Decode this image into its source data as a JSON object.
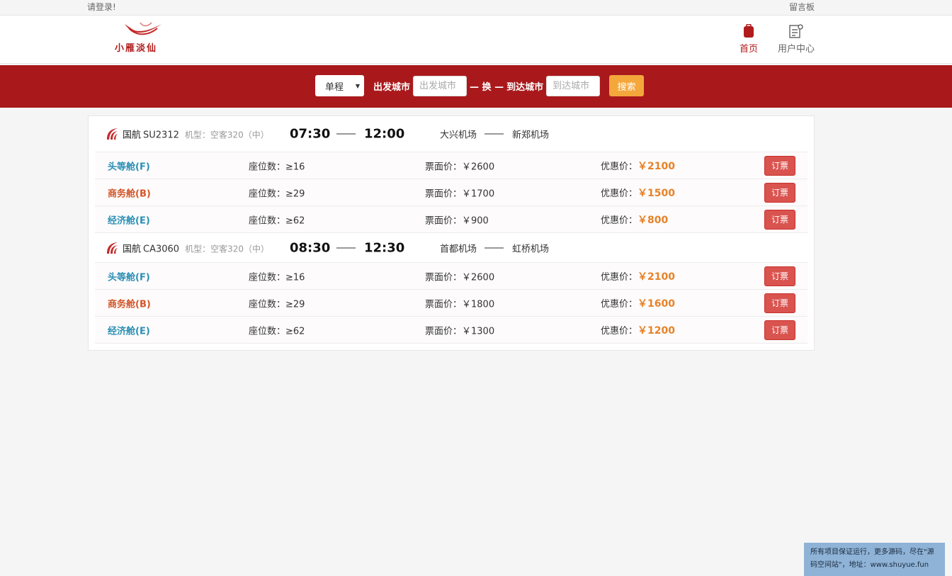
{
  "topbar": {
    "login": "请登录!",
    "board": "留言板"
  },
  "header": {
    "logo_text": "小雁淡仙",
    "nav": [
      {
        "label": "首页",
        "icon": "suitcase-icon",
        "color": "#b01c1c"
      },
      {
        "label": "用户中心",
        "icon": "user-center-icon",
        "color": "#666666"
      }
    ]
  },
  "search": {
    "trip_type": "单程",
    "depart_label": "出发城市",
    "depart_placeholder": "出发城市",
    "swap_label": "— 换 —",
    "arrive_label": "到达城市",
    "arrive_placeholder": "到达城市",
    "search_button": "搜索"
  },
  "flights": [
    {
      "airline": "国航",
      "code": "SU2312",
      "model": "机型：空客320（中）",
      "depart_time": "07:30",
      "arrive_time": "12:00",
      "depart_airport": "大兴机场",
      "arrive_airport": "新郑机场",
      "cabins": [
        {
          "name": "头等舱(F)",
          "color": "#2a8fb5",
          "seats": "座位数：≥16",
          "face": "票面价：￥2600",
          "disc_label": "优惠价：",
          "disc": "￥2100",
          "book": "订票"
        },
        {
          "name": "商务舱(B)",
          "color": "#d2562a",
          "seats": "座位数：≥29",
          "face": "票面价：￥1700",
          "disc_label": "优惠价：",
          "disc": "￥1500",
          "book": "订票"
        },
        {
          "name": "经济舱(E)",
          "color": "#2a8fb5",
          "seats": "座位数：≥62",
          "face": "票面价：￥900",
          "disc_label": "优惠价：",
          "disc": "￥800",
          "book": "订票"
        }
      ]
    },
    {
      "airline": "国航",
      "code": "CA3060",
      "model": "机型：空客320（中）",
      "depart_time": "08:30",
      "arrive_time": "12:30",
      "depart_airport": "首都机场",
      "arrive_airport": "虹桥机场",
      "cabins": [
        {
          "name": "头等舱(F)",
          "color": "#2a8fb5",
          "seats": "座位数：≥16",
          "face": "票面价：￥2600",
          "disc_label": "优惠价：",
          "disc": "￥2100",
          "book": "订票"
        },
        {
          "name": "商务舱(B)",
          "color": "#d2562a",
          "seats": "座位数：≥29",
          "face": "票面价：￥1800",
          "disc_label": "优惠价：",
          "disc": "￥1600",
          "book": "订票"
        },
        {
          "name": "经济舱(E)",
          "color": "#2a8fb5",
          "seats": "座位数：≥62",
          "face": "票面价：￥1300",
          "disc_label": "优惠价：",
          "disc": "￥1200",
          "book": "订票"
        }
      ]
    }
  ],
  "watermark": "所有项目保证运行，更多源码，尽在\"源码空间站\"，地址：www.shuyue.fun"
}
